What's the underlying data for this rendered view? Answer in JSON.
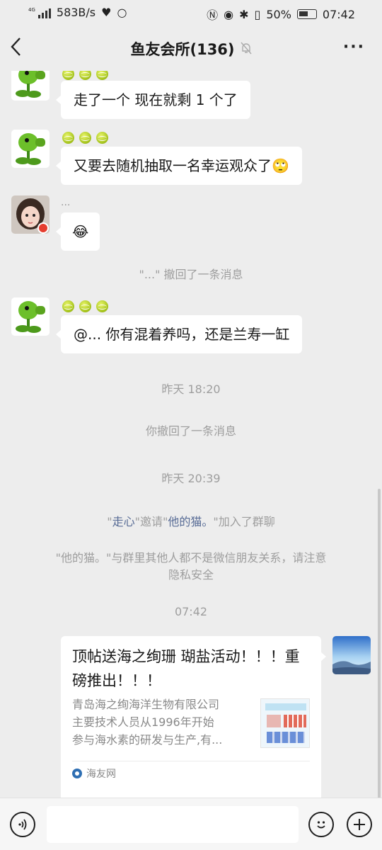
{
  "status": {
    "network_type": "4G",
    "speed": "583B/s",
    "battery_percent": "50%",
    "time": "07:42"
  },
  "nav": {
    "back_icon": "chevron-left-icon",
    "title": "鱼友会所(136)",
    "mute_icon": "bell-off-icon",
    "more_icon": "ellipsis-icon"
  },
  "messages": [
    {
      "type": "text",
      "sender_avatar": "peashooter",
      "text": "走了一个 现在就剩 1 个了"
    },
    {
      "type": "text",
      "sender_avatar": "peashooter",
      "text": "又要去随机抽取一名幸运观众了🙄"
    },
    {
      "type": "text",
      "sender_avatar": "girl",
      "nickname": "...",
      "text": "😂"
    },
    {
      "type": "system",
      "text": "\"...\" 撤回了一条消息"
    },
    {
      "type": "text",
      "sender_avatar": "peashooter",
      "text": "@... 你有混着养吗，还是兰寿一缸"
    },
    {
      "type": "time",
      "text": "昨天 18:20"
    },
    {
      "type": "system",
      "text": "你撤回了一条消息"
    },
    {
      "type": "time",
      "text": "昨天 20:39"
    },
    {
      "type": "system",
      "quote_open": "\"",
      "inviter": "走心",
      "mid": "\"邀请\"",
      "invitee": "他的猫。",
      "end": "\"加入了群聊"
    },
    {
      "type": "system",
      "line1": "\"他的猫。\"与群里其他人都不是微信朋友关系，请注意",
      "line2": "隐私安全"
    },
    {
      "type": "time",
      "text": "07:42"
    },
    {
      "type": "link",
      "title": "顶帖送海之绚珊 瑚盐活动！！！重磅推出！！！",
      "desc_line1": "青岛海之绚海洋生物有限公司",
      "desc_line2": "主要技术人员从1996年开始",
      "desc_line3": "参与海水素的研发与生产,有...",
      "source": "海友网"
    }
  ],
  "input_bar": {
    "voice_icon": "voice-icon",
    "emoji_icon": "emoji-icon",
    "plus_icon": "plus-icon",
    "input_placeholder": ""
  }
}
